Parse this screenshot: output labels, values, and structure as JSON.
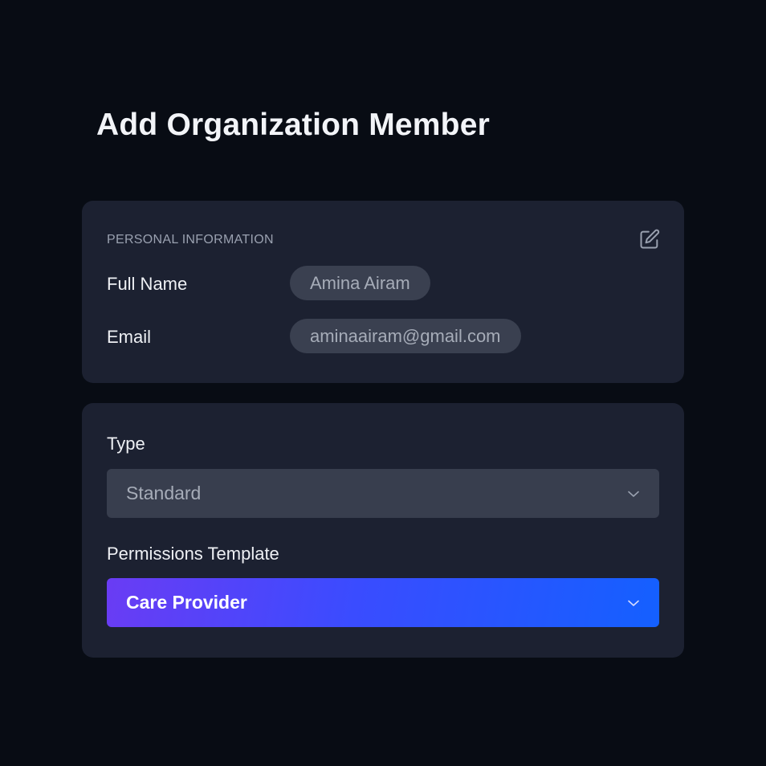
{
  "page": {
    "title": "Add Organization Member"
  },
  "personal_info": {
    "section_title": "PERSONAL INFORMATION",
    "edit_icon": "edit-icon",
    "full_name_label": "Full Name",
    "full_name_value": "Amina Airam",
    "email_label": "Email",
    "email_value": "aminaairam@gmail.com"
  },
  "membership": {
    "type_label": "Type",
    "type_value": "Standard",
    "permissions_label": "Permissions Template",
    "permissions_value": "Care Provider",
    "chevron_icon": "chevron-down-icon"
  },
  "colors": {
    "background": "#080c14",
    "card": "#1c2131",
    "pill": "#3a4050",
    "select": "#383e4e",
    "accent_start": "#6a3cf4",
    "accent_end": "#1460ff"
  }
}
